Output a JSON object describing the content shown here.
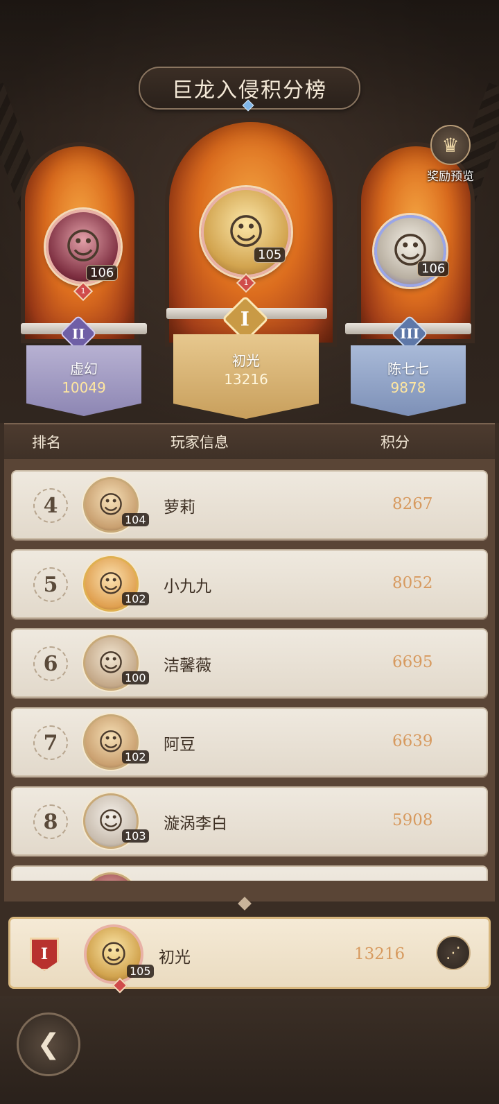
{
  "header": {
    "title": "巨龙入侵积分榜",
    "reward_preview_label": "奖励预览"
  },
  "podium": [
    {
      "rank": "II",
      "name": "虚幻",
      "score": "10049",
      "level": "106",
      "badge": "1"
    },
    {
      "rank": "I",
      "name": "初光",
      "score": "13216",
      "level": "105",
      "badge": "1"
    },
    {
      "rank": "III",
      "name": "陈七七",
      "score": "9878",
      "level": "106"
    }
  ],
  "list": {
    "columns": {
      "rank": "排名",
      "info": "玩家信息",
      "score": "积分"
    },
    "rows": [
      {
        "rank": "4",
        "name": "萝莉",
        "level": "104",
        "score": "8267"
      },
      {
        "rank": "5",
        "name": "小九九",
        "level": "102",
        "score": "8052"
      },
      {
        "rank": "6",
        "name": "洁馨薇",
        "level": "100",
        "score": "6695"
      },
      {
        "rank": "7",
        "name": "阿豆",
        "level": "102",
        "score": "6639"
      },
      {
        "rank": "8",
        "name": "漩涡李白",
        "level": "103",
        "score": "5908"
      }
    ]
  },
  "me": {
    "rank": "I",
    "name": "初光",
    "level": "105",
    "badge": "1",
    "score": "13216"
  },
  "icons": {
    "reward": "crown-chest-icon",
    "share": "share-icon",
    "back": "back-arrow-icon"
  },
  "colors": {
    "accent_score": "#d79a5f",
    "gold": "#c99a45",
    "silver": "#8d86b3",
    "bronze": "#7d90b7"
  }
}
